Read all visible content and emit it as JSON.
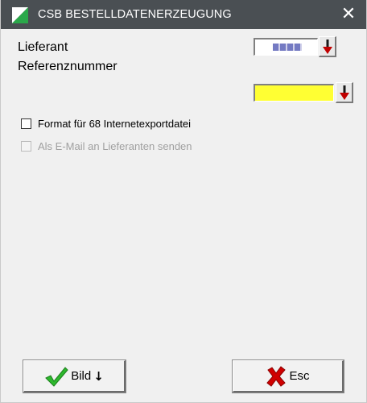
{
  "window": {
    "title": "CSB BESTELLDATENERZEUGUNG",
    "close_icon": "close-icon",
    "app_icon": "app-icon-green-slash"
  },
  "form": {
    "lieferant_label": "Lieferant",
    "referenz_label": "Referenznummer",
    "dropdown_icon": "arrow-down-icon"
  },
  "options": {
    "format_label": "Format für 68 Internetexportdatei",
    "format_checked": false,
    "email_label": "Als E-Mail an Lieferanten senden",
    "email_checked": false,
    "email_enabled": false
  },
  "buttons": {
    "bild_label": "Bild",
    "bild_icon": "check-icon",
    "bild_arrow": "↓",
    "esc_label": "Esc",
    "esc_icon": "cross-icon"
  },
  "colors": {
    "titlebar": "#4a4f53",
    "dialog_bg": "#f0f0f0",
    "highlight_field": "#ffff33",
    "dropdown_arrow": "#c00000",
    "check_green": "#2db82d",
    "cross_red": "#d00000"
  }
}
